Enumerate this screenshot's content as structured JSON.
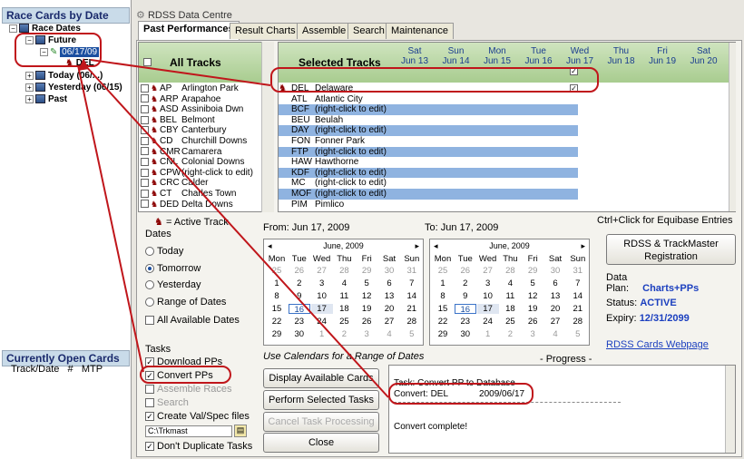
{
  "left": {
    "header1": "Race Cards by Date",
    "tree": {
      "root": "Race Dates",
      "future": "Future",
      "date_selected": "06/17/09",
      "child_track": "DEL",
      "today": "Today (06/...)",
      "yesterday": "Yesterday (06/15)",
      "past": "Past"
    },
    "header2": "Currently Open Cards",
    "cols": "Track/Date   #   MTP"
  },
  "window_title": "RDSS Data Centre",
  "tabs": [
    "Past Performances",
    "Result Charts",
    "Assemble",
    "Search",
    "Maintenance"
  ],
  "tracks": {
    "header": "All Tracks",
    "rows": [
      {
        "code": "AP",
        "name": "Arlington Park"
      },
      {
        "code": "ARP",
        "name": "Arapahoe"
      },
      {
        "code": "ASD",
        "name": "Assiniboia Dwn"
      },
      {
        "code": "BEL",
        "name": "Belmont"
      },
      {
        "code": "CBY",
        "name": "Canterbury"
      },
      {
        "code": "CD",
        "name": "Churchill Downs"
      },
      {
        "code": "CMR",
        "name": "Camarera"
      },
      {
        "code": "CNL",
        "name": "Colonial Downs"
      },
      {
        "code": "CPW",
        "name": "(right-click to edit)"
      },
      {
        "code": "CRC",
        "name": "Calder"
      },
      {
        "code": "CT",
        "name": "Charles Town"
      },
      {
        "code": "DED",
        "name": "Delta Downs"
      }
    ]
  },
  "selected": {
    "header": "Selected Tracks",
    "days": [
      {
        "dow": "Sat",
        "date": "Jun 13"
      },
      {
        "dow": "Sun",
        "date": "Jun 14"
      },
      {
        "dow": "Mon",
        "date": "Jun 15"
      },
      {
        "dow": "Tue",
        "date": "Jun 16"
      },
      {
        "dow": "Wed",
        "date": "Jun 17"
      },
      {
        "dow": "Thu",
        "date": "Jun 18"
      },
      {
        "dow": "Fri",
        "date": "Jun 19"
      },
      {
        "dow": "Sat",
        "date": "Jun 20"
      }
    ],
    "rows": [
      {
        "code": "DEL",
        "name": "Delaware"
      },
      {
        "code": "ATL",
        "name": "Atlantic City"
      },
      {
        "code": "BCF",
        "name": "(right-click to edit)"
      },
      {
        "code": "BEU",
        "name": "Beulah"
      },
      {
        "code": "DAY",
        "name": "(right-click to edit)"
      },
      {
        "code": "FON",
        "name": "Fonner Park"
      },
      {
        "code": "FTP",
        "name": "(right-click to edit)"
      },
      {
        "code": "HAW",
        "name": "Hawthorne"
      },
      {
        "code": "KDF",
        "name": "(right-click to edit)"
      },
      {
        "code": "MC",
        "name": "(right-click to edit)"
      },
      {
        "code": "MOF",
        "name": "(right-click to edit)"
      },
      {
        "code": "PIM",
        "name": "Pimlico"
      }
    ]
  },
  "active_legend": "= Active Track",
  "dates": {
    "label": "Dates",
    "options": [
      "Today",
      "Tomorrow",
      "Yesterday",
      "Range of Dates"
    ],
    "selected": "Tomorrow",
    "all_available": "All Available Dates"
  },
  "from_label": "From: Jun 17, 2009",
  "to_label": "To: Jun 17, 2009",
  "ctrl_click": "Ctrl+Click for Equibase Entries",
  "calendar": {
    "month": "June, 2009",
    "dow": [
      "Mon",
      "Tue",
      "Wed",
      "Thu",
      "Fri",
      "Sat",
      "Sun"
    ],
    "weeks": [
      [
        "25",
        "26",
        "27",
        "28",
        "29",
        "30",
        "31"
      ],
      [
        "1",
        "2",
        "3",
        "4",
        "5",
        "6",
        "7"
      ],
      [
        "8",
        "9",
        "10",
        "11",
        "12",
        "13",
        "14"
      ],
      [
        "15",
        "16",
        "17",
        "18",
        "19",
        "20",
        "21"
      ],
      [
        "22",
        "23",
        "24",
        "25",
        "26",
        "27",
        "28"
      ],
      [
        "29",
        "30",
        "1",
        "2",
        "3",
        "4",
        "5"
      ]
    ]
  },
  "registration_button": "RDSS & TrackMaster Registration",
  "data": {
    "label": "Data",
    "plan_label": "Plan:",
    "plan": "Charts+PPs",
    "status_label": "Status:",
    "status": "ACTIVE",
    "expiry_label": "Expiry:",
    "expiry": "12/31/2099"
  },
  "webpage_link": "RDSS Cards Webpage",
  "tasks": {
    "label": "Tasks",
    "items": [
      {
        "label": "Download PPs",
        "checked": true
      },
      {
        "label": "Convert PPs",
        "checked": true
      },
      {
        "label": "Assemble Races",
        "checked": false
      },
      {
        "label": "Search",
        "checked": false
      },
      {
        "label": "Create Val/Spec files",
        "checked": true
      }
    ],
    "path": "C:\\Trkmast",
    "no_dup": "Don't Duplicate Tasks"
  },
  "use_calendars": "Use Calendars for a Range of Dates",
  "progress": "- Progress -",
  "buttons": [
    "Display Available Cards",
    "Perform Selected Tasks",
    "Cancel Task Processing",
    "Close"
  ],
  "log": {
    "line1": "Task: Convert PP to Database",
    "line2_track": "Convert: DEL",
    "line2_date": "2009/06/17",
    "line3": "Convert complete!"
  }
}
